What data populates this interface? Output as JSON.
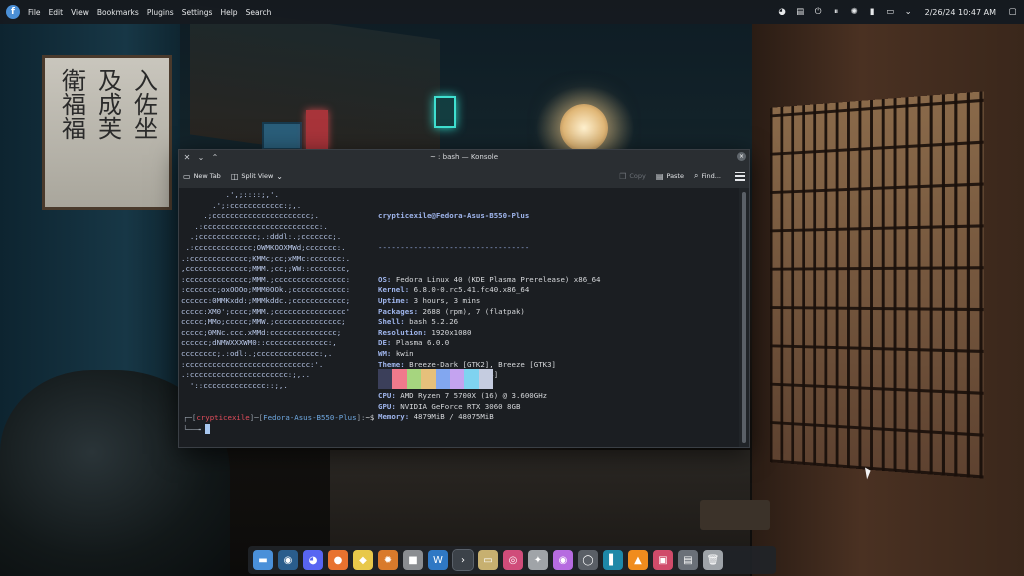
{
  "top_panel": {
    "menu": [
      "File",
      "Edit",
      "View",
      "Bookmarks",
      "Plugins",
      "Settings",
      "Help",
      "Search"
    ],
    "clock": "2/26/24 10:47 AM"
  },
  "window": {
    "title": "~ : bash — Konsole",
    "toolbar": {
      "new_tab": "New Tab",
      "split_view": "Split View",
      "copy": "Copy",
      "paste": "Paste",
      "find": "Find..."
    }
  },
  "terminal": {
    "logo_lines": [
      "          .',;::::;,'.",
      "       .';:cccccccccccc:;,.",
      "     .;cccccccccccccccccccccc;.",
      "   .:cccccccccccccccccccccccccc:.",
      "  .;ccccccccccccc;.:dddl:.;ccccccc;.",
      " .:ccccccccccccc;OWMKOOXMWd;ccccccc:.",
      ".:ccccccccccccc;KMMc;cc;xMMc:ccccccc:.",
      ",cccccccccccccc;MMM.;cc;;WW::cccccccc,",
      ":cccccccccccccc;MMM.;cccccccccccccccc:",
      ":ccccccc;oxOOOo;MMM0OOk.;cccccccccccc:",
      "cccccc:0MMKxdd:;MMMkddc.;cccccccccccc;",
      "ccccc:XM0';cccc;MMM.;cccccccccccccccc'",
      "ccccc;MMo;ccccc;MMW.;ccccccccccccccc;",
      "ccccc;0MNc.ccc.xMMd:ccccccccccccccc;",
      "cccccc;dNMWXXXWM0::cccccccccccccc:,",
      "cccccccc;.:odl:.;cccccccccccccc:,.",
      ":cccccccccccccccccccccccccccc:'.",
      ".:cccccccccccccccccccccc:;,..",
      "  '::cccccccccccccc::;,."
    ],
    "header": "crypticexile@Fedora-Asus-B550-Plus",
    "separator": "----------------------------------",
    "info": [
      {
        "key": "OS",
        "value": "Fedora Linux 40 (KDE Plasma Prerelease) x86_64"
      },
      {
        "key": "Kernel",
        "value": "6.8.0-0.rc5.41.fc40.x86_64"
      },
      {
        "key": "Uptime",
        "value": "3 hours, 3 mins"
      },
      {
        "key": "Packages",
        "value": "2688 (rpm), 7 (flatpak)"
      },
      {
        "key": "Shell",
        "value": "bash 5.2.26"
      },
      {
        "key": "Resolution",
        "value": "1920x1080"
      },
      {
        "key": "DE",
        "value": "Plasma 6.0.0"
      },
      {
        "key": "WM",
        "value": "kwin"
      },
      {
        "key": "Theme",
        "value": "Breeze-Dark [GTK2], Breeze [GTK3]"
      },
      {
        "key": "Icons",
        "value": "breeze-dark [GTK2/3]"
      },
      {
        "key": "Terminal",
        "value": "konsole"
      },
      {
        "key": "CPU",
        "value": "AMD Ryzen 7 5700X (16) @ 3.600GHz"
      },
      {
        "key": "GPU",
        "value": "NVIDIA GeForce RTX 3060 8GB"
      },
      {
        "key": "Memory",
        "value": "4879MiB / 48075MiB"
      }
    ],
    "palette": [
      "#3b3f5a",
      "#f07a8c",
      "#a6d57f",
      "#e6c07b",
      "#82a7f0",
      "#c4a3f0",
      "#7fd3f0",
      "#c5cce0"
    ],
    "prompt": {
      "user": "crypticexile",
      "host": "Fedora-Asus-B550-Plus",
      "path": "~$"
    }
  },
  "dock": {
    "apps": [
      {
        "name": "files-icon",
        "glyph": "▬",
        "color": "#4a90d9"
      },
      {
        "name": "steam-icon",
        "glyph": "◉",
        "color": "#2a5d8c"
      },
      {
        "name": "discord-icon",
        "glyph": "◕",
        "color": "#5865f2"
      },
      {
        "name": "firefox-icon",
        "glyph": "●",
        "color": "#e8722f"
      },
      {
        "name": "python-icon",
        "glyph": "◆",
        "color": "#e8c84a"
      },
      {
        "name": "settings-icon",
        "glyph": "✹",
        "color": "#d97a2b"
      },
      {
        "name": "disk-icon",
        "glyph": "■",
        "color": "#8a8d91"
      },
      {
        "name": "writer-icon",
        "glyph": "W",
        "color": "#2f78c4"
      },
      {
        "name": "konsole-icon",
        "glyph": "›",
        "color": "#4a5058"
      },
      {
        "name": "scanner-icon",
        "glyph": "▭",
        "color": "#c7b070"
      },
      {
        "name": "color-picker-icon",
        "glyph": "◎",
        "color": "#d04c7a"
      },
      {
        "name": "game-icon",
        "glyph": "✦",
        "color": "#a0a4a8"
      },
      {
        "name": "media-icon",
        "glyph": "◉",
        "color": "#b66be0"
      },
      {
        "name": "obs-icon",
        "glyph": "◯",
        "color": "#5a5f66"
      },
      {
        "name": "editor-icon",
        "glyph": "▌",
        "color": "#1e88a8"
      },
      {
        "name": "vlc-icon",
        "glyph": "▲",
        "color": "#f08c1e"
      },
      {
        "name": "image-viewer-icon",
        "glyph": "▣",
        "color": "#d04b6a"
      },
      {
        "name": "system-monitor-icon",
        "glyph": "▤",
        "color": "#6a7078"
      },
      {
        "name": "trash-icon",
        "glyph": "🗑",
        "color": "#9ea3a8"
      }
    ]
  }
}
